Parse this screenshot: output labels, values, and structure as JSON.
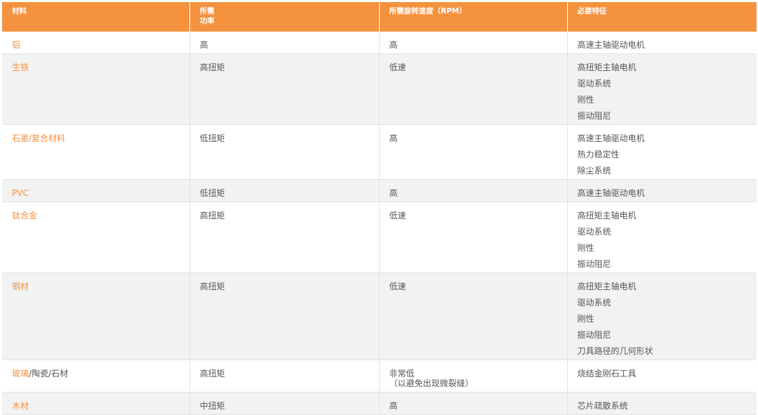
{
  "colors": {
    "header_bg": "#f5923e",
    "accent_text": "#f5923e",
    "row_alt_bg": "#f2f2f2"
  },
  "headers": [
    "材料",
    "所需\n功率",
    "所需旋转速度（RPM）",
    "必要特征"
  ],
  "rows": [
    {
      "material": "铝",
      "power": "高",
      "rpm": "高",
      "features": [
        "高速主轴驱动电机"
      ]
    },
    {
      "material": "生铁",
      "power": "高扭矩",
      "rpm": "低速",
      "features": [
        "高扭矩主轴电机",
        "驱动系统",
        "刚性",
        "振动阻尼"
      ]
    },
    {
      "material": "石墨/复合材料",
      "power": "低扭矩",
      "rpm": "高",
      "features": [
        "高速主轴驱动电机",
        "热力稳定性",
        "除尘系统"
      ]
    },
    {
      "material": "PVC",
      "power": "低扭矩",
      "rpm": "高",
      "features": [
        "高速主轴驱动电机"
      ]
    },
    {
      "material": "钛合金",
      "power": "高扭矩",
      "rpm": "低速",
      "features": [
        "高扭矩主轴电机",
        "驱动系统",
        "刚性",
        "振动阻尼"
      ]
    },
    {
      "material": "钢材",
      "power": "高扭矩",
      "rpm": "低速",
      "features": [
        "高扭矩主轴电机",
        "驱动系统",
        "刚性",
        "振动阻尼",
        "刀具路径的几何形状"
      ]
    },
    {
      "material_parts": [
        "玻璃",
        "/陶瓷/石材"
      ],
      "power": "高扭矩",
      "rpm_lines": [
        "非常低",
        "（以避免出现微裂缝）"
      ],
      "features": [
        "烧结金刚石工具"
      ]
    },
    {
      "material": "木材",
      "power": "中扭矩",
      "rpm": "高",
      "features": [
        "芯片疏散系统"
      ]
    }
  ]
}
